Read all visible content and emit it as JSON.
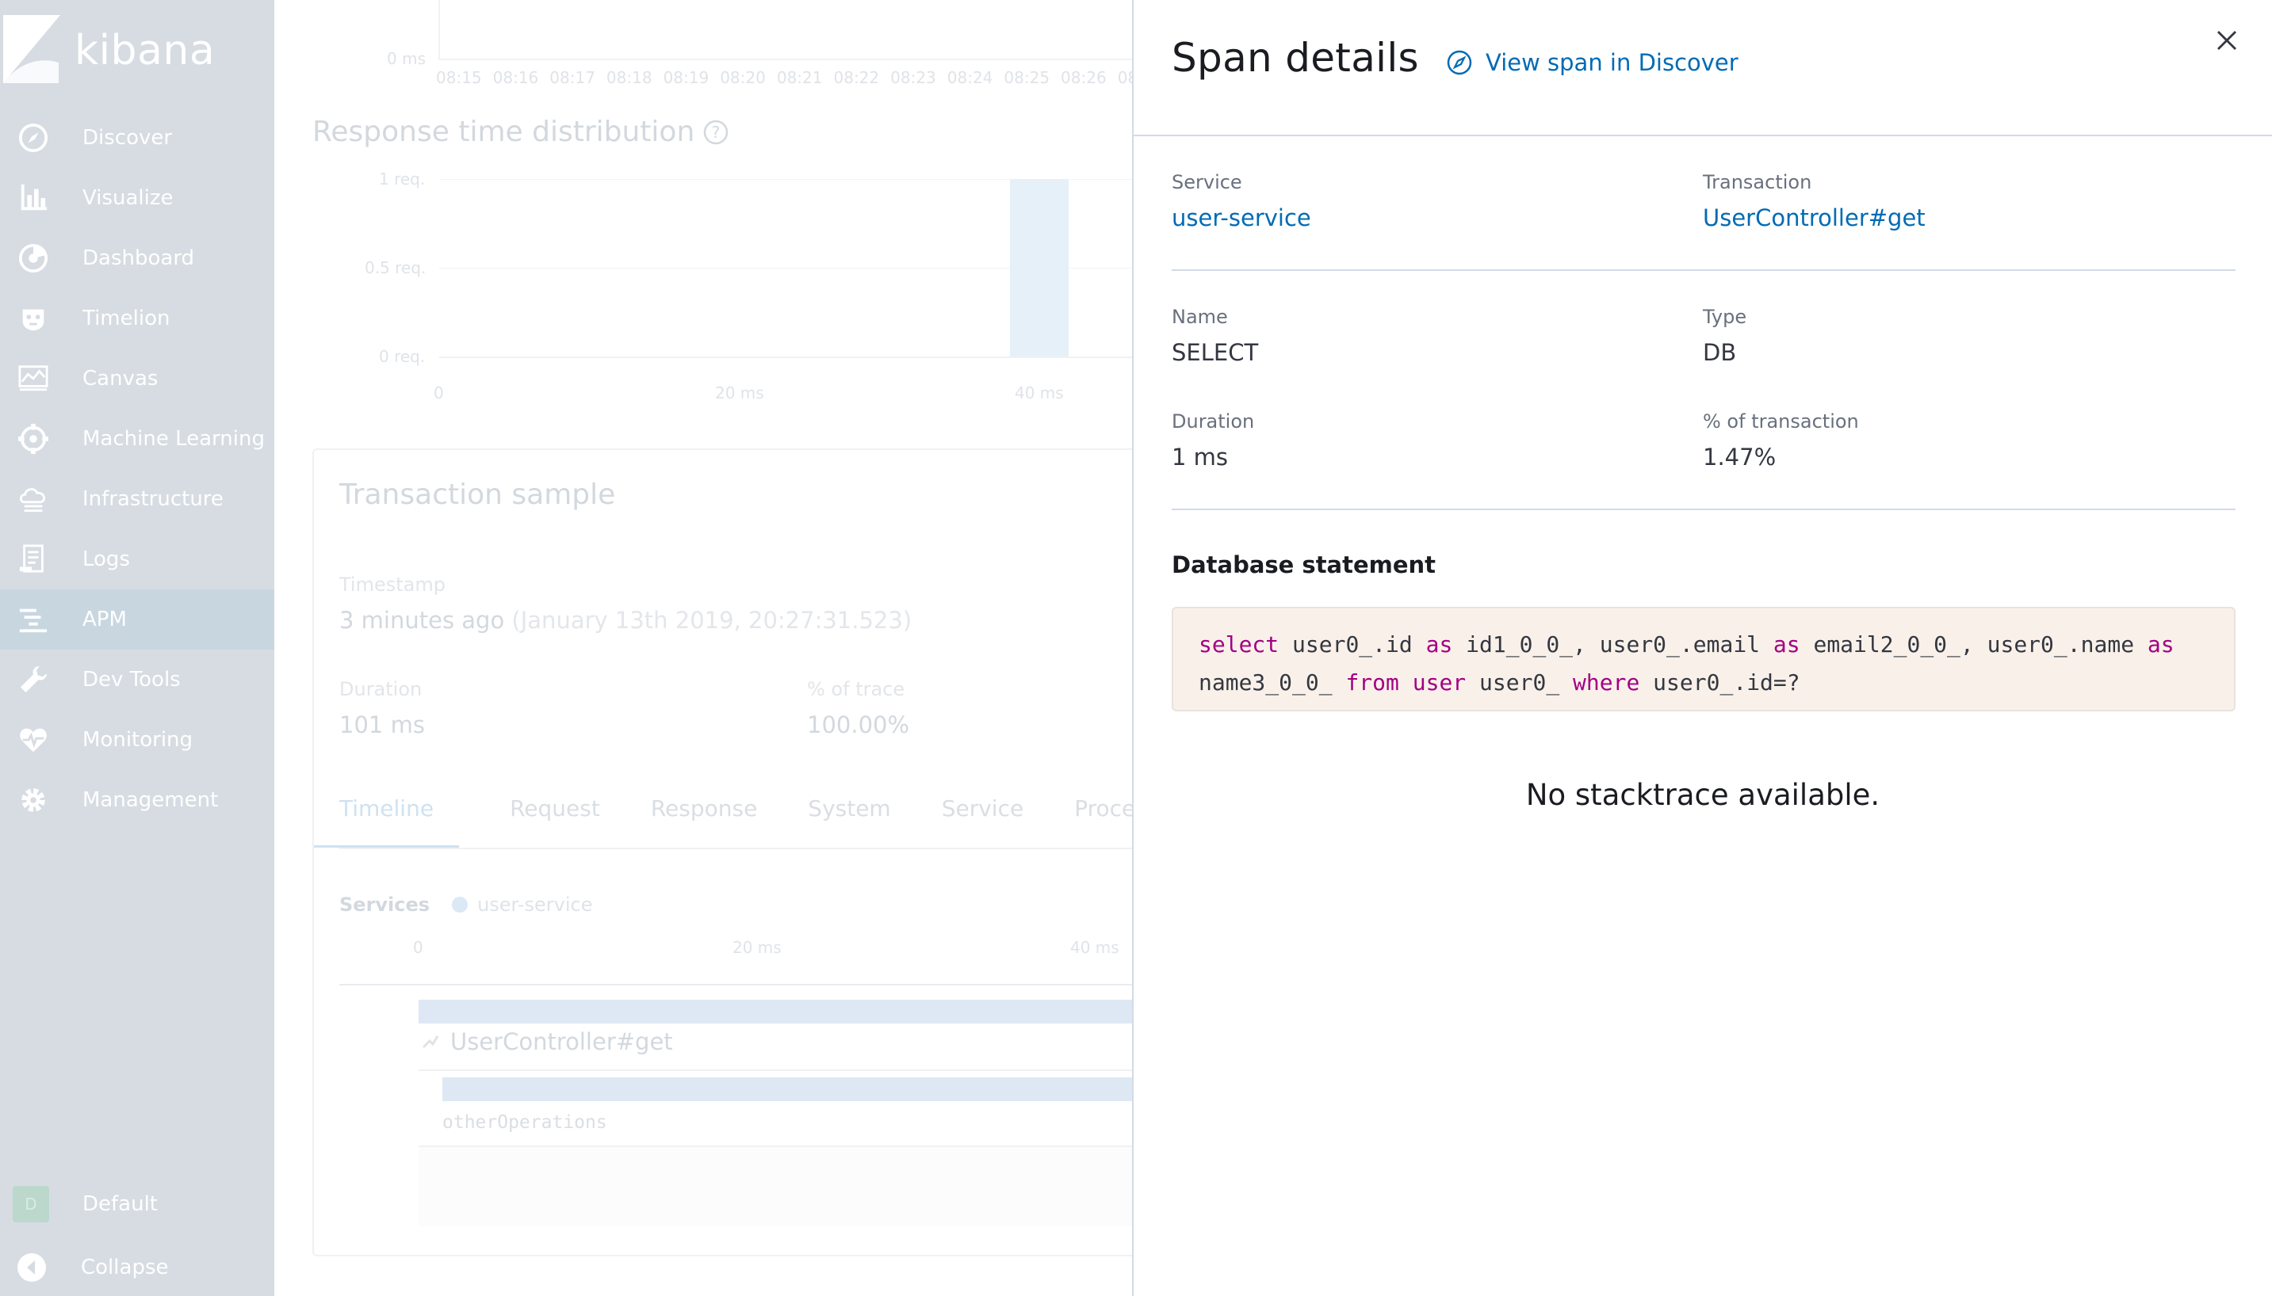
{
  "sidebar": {
    "brand": "kibana",
    "items": [
      {
        "label": "Discover",
        "icon": "compass-icon"
      },
      {
        "label": "Visualize",
        "icon": "bar-chart-icon"
      },
      {
        "label": "Dashboard",
        "icon": "dashboard-icon"
      },
      {
        "label": "Timelion",
        "icon": "timelion-icon"
      },
      {
        "label": "Canvas",
        "icon": "canvas-icon"
      },
      {
        "label": "Machine Learning",
        "icon": "machine-learning-icon"
      },
      {
        "label": "Infrastructure",
        "icon": "infrastructure-icon"
      },
      {
        "label": "Logs",
        "icon": "logs-icon"
      },
      {
        "label": "APM",
        "icon": "apm-icon",
        "active": true
      },
      {
        "label": "Dev Tools",
        "icon": "wrench-icon"
      },
      {
        "label": "Monitoring",
        "icon": "heartbeat-icon"
      },
      {
        "label": "Management",
        "icon": "gear-icon"
      }
    ],
    "space": {
      "avatar": "D",
      "label": "Default"
    },
    "collapse": "Collapse"
  },
  "background": {
    "top_chart": {
      "ylabel_zero": "0 ms",
      "x_ticks": [
        "08:15",
        "08:16",
        "08:17",
        "08:18",
        "08:19",
        "08:20",
        "08:21",
        "08:22",
        "08:23",
        "08:24",
        "08:25",
        "08:26",
        "08:"
      ]
    },
    "response_time": {
      "title": "Response time distribution",
      "y_ticks": [
        "1 req.",
        "0.5 req.",
        "0 req."
      ],
      "x_ticks": [
        "0",
        "20 ms",
        "40 ms"
      ]
    },
    "transaction_sample": {
      "title": "Transaction sample",
      "timestamp_label": "Timestamp",
      "timestamp_value": "3 minutes ago",
      "timestamp_detail": "(January 13th 2019, 20:27:31.523)",
      "duration_label": "Duration",
      "duration_value": "101 ms",
      "pct_label": "% of trace",
      "pct_value": "100.00%",
      "tabs": [
        "Timeline",
        "Request",
        "Response",
        "System",
        "Service",
        "Process"
      ],
      "services_label": "Services",
      "service_name": "user-service",
      "timeline_ticks": [
        "0",
        "20 ms",
        "40 ms"
      ],
      "transaction_name": "UserController#get",
      "span_name": "otherOperations"
    }
  },
  "flyout": {
    "title": "Span details",
    "discover_link": "View span in Discover",
    "service_label": "Service",
    "service_value": "user-service",
    "transaction_label": "Transaction",
    "transaction_value": "UserController#get",
    "name_label": "Name",
    "name_value": "SELECT",
    "type_label": "Type",
    "type_value": "DB",
    "duration_label": "Duration",
    "duration_value": "1 ms",
    "pct_label": "% of transaction",
    "pct_value": "1.47%",
    "db_title": "Database statement",
    "sql": {
      "select": "select",
      "p1": " user0_.id ",
      "as1": "as",
      "p2": " id1_0_0_, user0_.email ",
      "as2": "as",
      "p3": " email2_0_0_, user0_.name ",
      "as3": "as",
      "p4": "\nname3_0_0_ ",
      "from": "from",
      "p5": " ",
      "user": "user",
      "p6": " user0_ ",
      "where": "where",
      "p7": " user0_.id=?"
    },
    "no_stacktrace": "No stacktrace available."
  },
  "colors": {
    "link": "#006bb4",
    "sql_keyword": "#a30084",
    "code_bg": "#f9f1e9",
    "sidebar_bg": "#d6dce2"
  }
}
